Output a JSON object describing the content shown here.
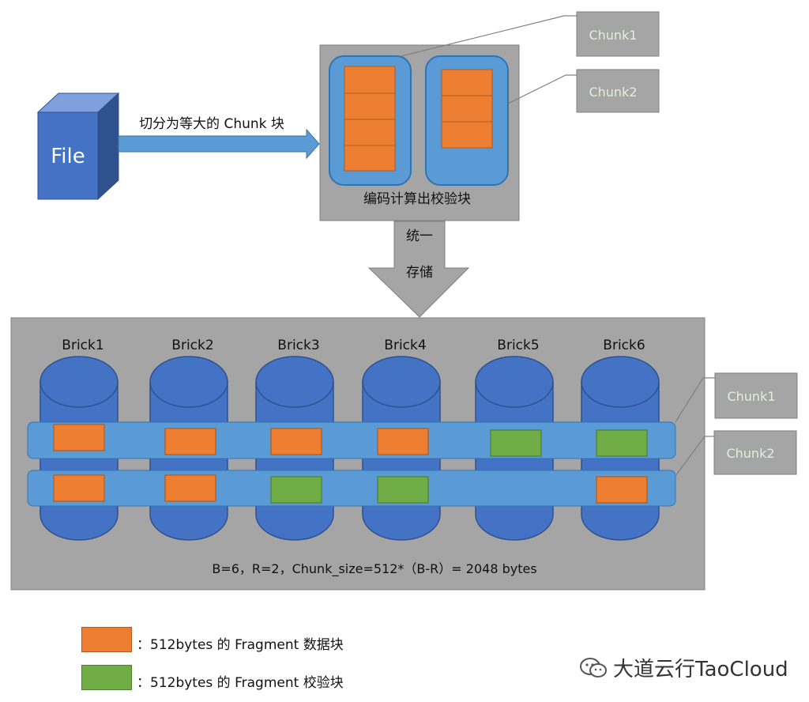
{
  "top": {
    "file_label": "File",
    "split_label": "切分为等大的 Chunk 块",
    "encode_label": "编码计算出校验块",
    "store_label_1": "统一",
    "store_label_2": "存储",
    "callouts": [
      "Chunk1",
      "Chunk2"
    ]
  },
  "bottom": {
    "bricks": [
      "Brick1",
      "Brick2",
      "Brick3",
      "Brick4",
      "Brick5",
      "Brick6"
    ],
    "chunk1_row": [
      "data",
      "data",
      "data",
      "data",
      "parity",
      "parity"
    ],
    "chunk2_row": [
      "data",
      "data",
      "parity",
      "parity",
      "none",
      "data"
    ],
    "callouts": [
      "Chunk1",
      "Chunk2"
    ],
    "formula": "B=6，R=2，Chunk_size=512*（B-R）= 2048 bytes"
  },
  "legend": {
    "data_label": "：512bytes 的 Fragment 数据块",
    "parity_label": "：512bytes 的 Fragment 校验块"
  },
  "watermark": "大道云行TaoCloud",
  "colors": {
    "data": "#ed7d31",
    "parity": "#70ad47",
    "brick": "#4472c4",
    "band": "#5b9bd5",
    "panel": "#a5a5a5",
    "callout": "#a5a5a5"
  }
}
